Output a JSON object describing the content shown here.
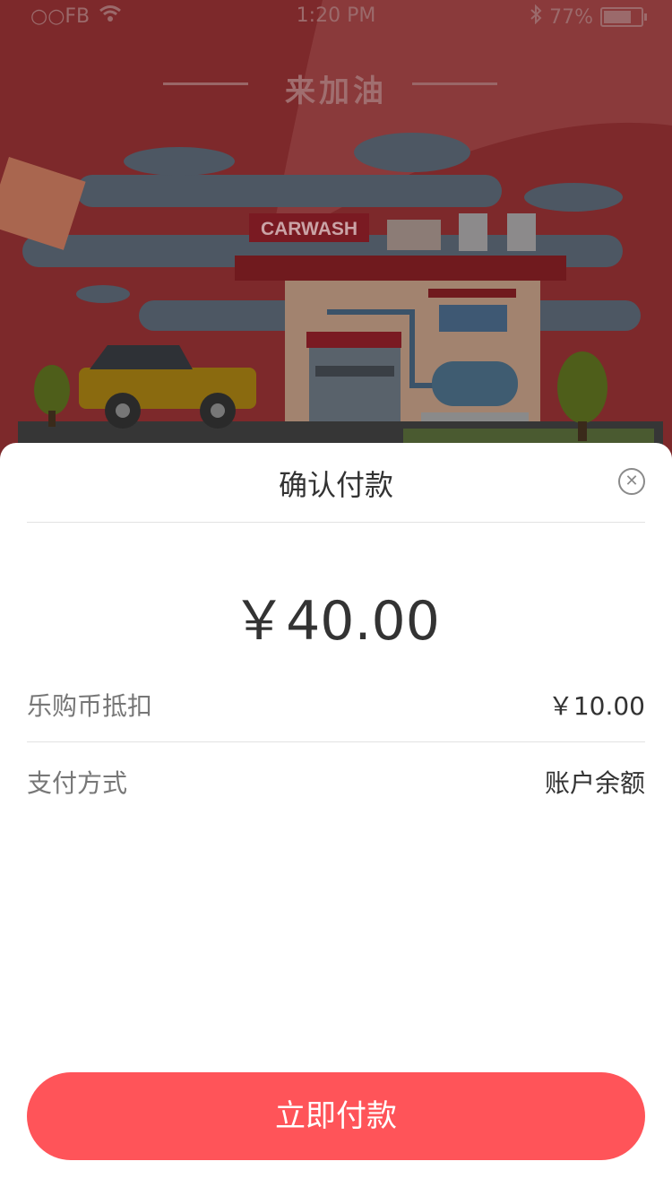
{
  "status_bar": {
    "carrier": "○○FB",
    "time": "1:20 PM",
    "battery_percent": "77%",
    "battery_level": 0.77,
    "icons": [
      "wifi-icon",
      "bluetooth-icon",
      "battery-icon"
    ]
  },
  "banner": {
    "title": "来加油",
    "sign_text": "CARWASH"
  },
  "sheet": {
    "title": "确认付款",
    "amount": "￥40.00",
    "rows": [
      {
        "label": "乐购币抵扣",
        "value": "￥10.00"
      },
      {
        "label": "支付方式",
        "value": "账户余额"
      }
    ],
    "pay_button": "立即付款"
  },
  "colors": {
    "accent": "#ff5459",
    "background_dim": "#7d292b"
  }
}
